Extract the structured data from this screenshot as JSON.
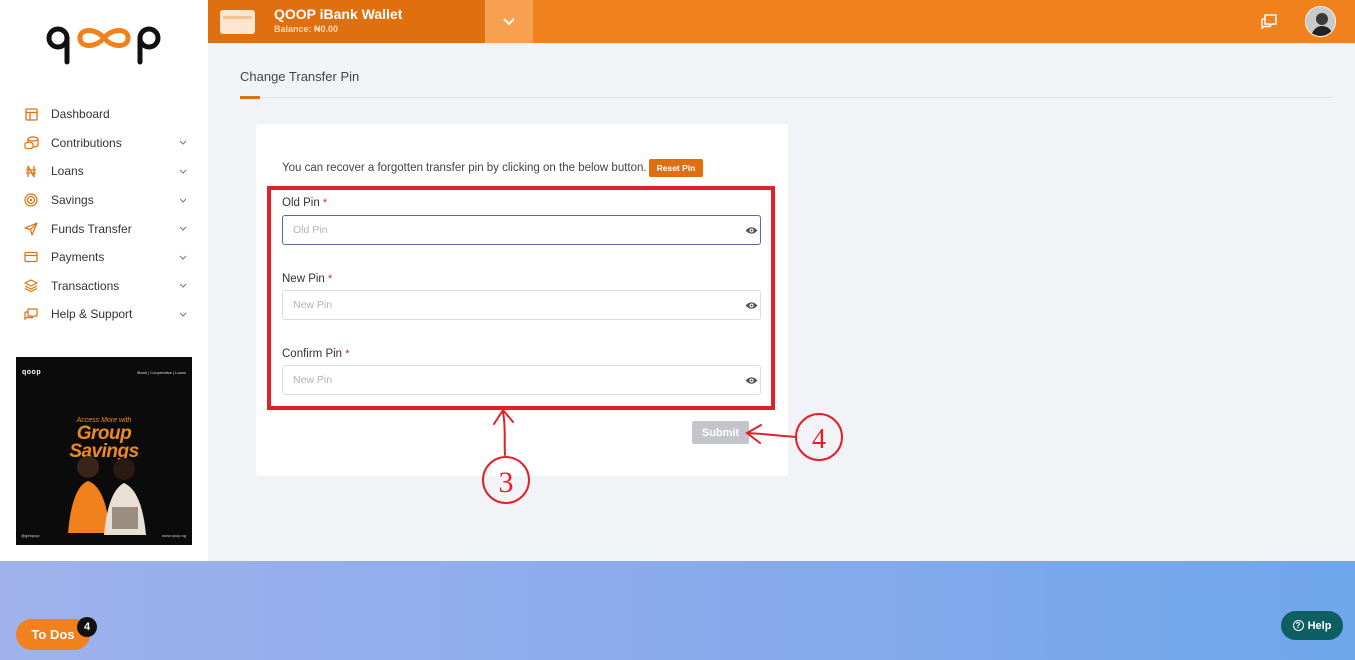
{
  "brand": {
    "logo_text": "qoop"
  },
  "sidebar": {
    "items": [
      {
        "label": "Dashboard",
        "icon": "layout-icon",
        "has_chevron": false
      },
      {
        "label": "Contributions",
        "icon": "coins-icon",
        "has_chevron": true
      },
      {
        "label": "Loans",
        "icon": "naira-icon",
        "has_chevron": true
      },
      {
        "label": "Savings",
        "icon": "target-icon",
        "has_chevron": true
      },
      {
        "label": "Funds Transfer",
        "icon": "send-icon",
        "has_chevron": true
      },
      {
        "label": "Payments",
        "icon": "credit-card-icon",
        "has_chevron": true
      },
      {
        "label": "Transactions",
        "icon": "layers-icon",
        "has_chevron": true
      },
      {
        "label": "Help & Support",
        "icon": "support-icon",
        "has_chevron": true
      }
    ],
    "promo": {
      "logo": "qoop",
      "tagline": "iBank | Cooperative | Loans",
      "access_text": "Access More with",
      "title_line1": "Group",
      "title_line2": "Savings",
      "footer_left": "@getqoop",
      "footer_right": "www.qoop.ng"
    }
  },
  "topbar": {
    "wallet_title": "QOOP iBank Wallet",
    "wallet_balance": "Balance: ₦0.00"
  },
  "page": {
    "title": "Change Transfer Pin"
  },
  "form": {
    "recover_text": "You can recover a forgotten transfer pin by clicking on the below button.",
    "reset_label": "Reset Pin",
    "fields": [
      {
        "label": "Old Pin",
        "placeholder": "Old Pin"
      },
      {
        "label": "New Pin",
        "placeholder": "New Pin"
      },
      {
        "label": "Confirm Pin",
        "placeholder": "New Pin"
      }
    ],
    "required_mark": "*",
    "submit_label": "Submit"
  },
  "annotations": {
    "label_3": "3",
    "label_4": "4",
    "color": "#e3202a"
  },
  "footer": {
    "todos_label": "To Dos",
    "todos_count": "4",
    "help_label": "Help",
    "help_q": "?"
  },
  "colors": {
    "accent": "#f0811d",
    "accent_dark": "#e0700f",
    "help": "#0d5f63"
  }
}
